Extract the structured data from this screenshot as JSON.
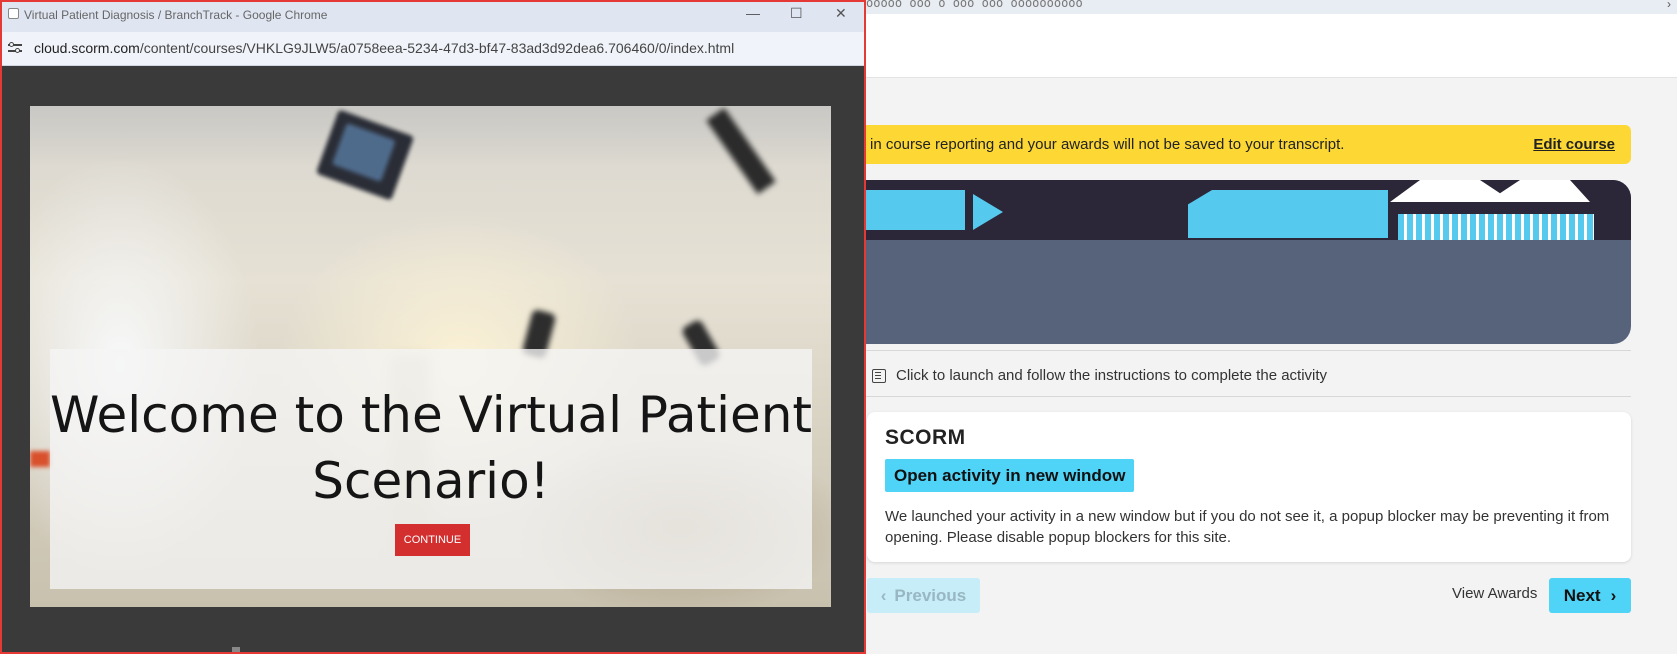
{
  "popup_window": {
    "title": "Virtual Patient Diagnosis / BranchTrack - Google Chrome",
    "controls": {
      "minimize": "—",
      "maximize": "☐",
      "close": "✕"
    },
    "address_bar": {
      "domain": "cloud.scorm.com",
      "path": "/content/courses/VHKLG9JLW5/a0758eea-5234-47d3-bf47-83ad3d92dea6.706460/0/index.html"
    },
    "content": {
      "welcome_heading": "Welcome to the Virtual Patient Scenario!",
      "continue_label": "CONTINUE"
    },
    "border_color": "#e53935"
  },
  "background_page": {
    "top_strip_text": "ooooo ooo o ooo ooo  oooooooooo",
    "top_chevron": "›",
    "banner": {
      "text": "in course reporting and your awards will not be saved to your transcript.",
      "action_label": "Edit course",
      "color": "#fdd835"
    },
    "instructions": "Click to launch and follow the instructions to complete the activity",
    "activity_card": {
      "title": "SCORM",
      "open_button_label": "Open activity in new window",
      "message": "We launched your activity in a new window but if you do not see it, a popup blocker may be preventing it from opening. Please disable popup blockers for this site."
    },
    "navigation": {
      "previous_label": "Previous",
      "previous_chevron": "‹",
      "view_awards_label": "View Awards",
      "next_label": "Next",
      "next_chevron": "›"
    },
    "accent_color": "#4fd3f7"
  }
}
